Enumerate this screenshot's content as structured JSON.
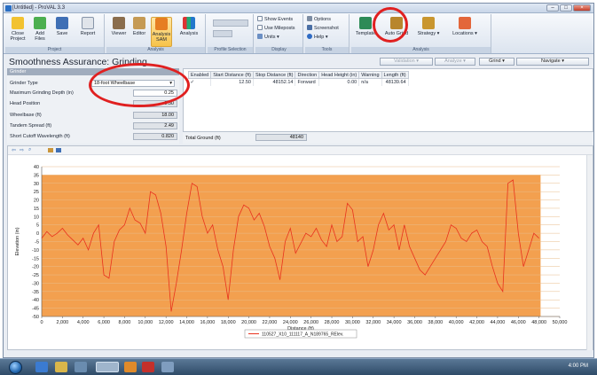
{
  "app": {
    "title": "[Untitled] - ProVAL 3.3"
  },
  "window_buttons": [
    "–",
    "□",
    "×"
  ],
  "ribbon": {
    "project_group": "Project",
    "close_project": "Close Project",
    "add_files": "Add Files",
    "save": "Save",
    "report": "Report",
    "view_group": "View",
    "viewer": "Viewer",
    "editor": "Editor",
    "analysis_sam": "Analysis SAM",
    "analysis": "Analysis",
    "profile_group": "Profile Selection",
    "display_group": "Display",
    "show_events": "Show Events",
    "use_mileposts": "Use Mileposts",
    "units": "Units",
    "tools_group": "Tools",
    "options": "Options",
    "screenshot": "Screenshot",
    "help": "Help",
    "template": "Template",
    "auto_grind": "Auto Grind",
    "strategy": "Strategy",
    "locations": "Locations",
    "analysis_group": "Analysis"
  },
  "page": {
    "title": "Smoothness Assurance: Grinding",
    "btn_validation": "Validation",
    "btn_analyze": "Analyze",
    "btn_grind": "Grind",
    "btn_navigate": "Navigate"
  },
  "grinder": {
    "header": "Grinder",
    "type_label": "Grinder Type",
    "type_value": "18-foot Wheelbase",
    "depth_label": "Maximum Grinding Depth (in)",
    "depth_value": "0.25",
    "head_label": "Head Position",
    "head_value": "9.50",
    "wheelbase_label": "Wheelbase (ft)",
    "wheelbase_value": "18.00",
    "tandem_label": "Tandem Spread (ft)",
    "tandem_value": "2.49",
    "cutoff_label": "Short Cutoff Wavelength (ft)",
    "cutoff_value": "0.820"
  },
  "table": {
    "headers": [
      "Enabled",
      "Start Distance (ft)",
      "Stop Distance (ft)",
      "Direction",
      "Head Height (in)",
      "Warning",
      "Length (ft)"
    ],
    "rows": [
      [
        "✓",
        "12.50",
        "48152.14",
        "Forward",
        "0.00",
        "n/a",
        "48139.64"
      ]
    ]
  },
  "total": {
    "label": "Total Ground (ft)",
    "value": "48140"
  },
  "chart_data": {
    "type": "line",
    "xlabel": "Distance (ft)",
    "ylabel": "Elevation (in)",
    "xlim": [
      0,
      50000
    ],
    "ylim": [
      -50,
      40
    ],
    "xticks": [
      "0",
      "2,000",
      "4,000",
      "6,000",
      "8,000",
      "10,000",
      "12,000",
      "14,000",
      "16,000",
      "18,000",
      "20,000",
      "22,000",
      "24,000",
      "26,000",
      "28,000",
      "30,000",
      "32,000",
      "34,000",
      "36,000",
      "38,000",
      "40,000",
      "42,000",
      "44,000",
      "46,000",
      "48,000",
      "50,000"
    ],
    "yticks": [
      "40",
      "35",
      "30",
      "25",
      "20",
      "15",
      "10",
      "5",
      "0",
      "-5",
      "-10",
      "-15",
      "-20",
      "-25",
      "-30",
      "-35",
      "-40",
      "-45",
      "-50"
    ],
    "shaded_region": {
      "x": [
        0,
        48150
      ],
      "y": [
        -50,
        35
      ]
    },
    "series": [
      {
        "name": "110527_X10_111117_A_N189765_RElev.",
        "color": "#e8321e",
        "x": [
          0,
          500,
          1000,
          1500,
          2000,
          2500,
          3000,
          3500,
          4000,
          4500,
          5000,
          5500,
          6000,
          6500,
          7000,
          7500,
          8000,
          8500,
          9000,
          9500,
          10000,
          10500,
          11000,
          11500,
          12000,
          12500,
          13000,
          13500,
          14000,
          14500,
          15000,
          15500,
          16000,
          16500,
          17000,
          17500,
          18000,
          18500,
          19000,
          19500,
          20000,
          20500,
          21000,
          21500,
          22000,
          22500,
          23000,
          23500,
          24000,
          24500,
          25000,
          25500,
          26000,
          26500,
          27000,
          27500,
          28000,
          28500,
          29000,
          29500,
          30000,
          30500,
          31000,
          31500,
          32000,
          32500,
          33000,
          33500,
          34000,
          34500,
          35000,
          35500,
          36000,
          36500,
          37000,
          37500,
          38000,
          38500,
          39000,
          39500,
          40000,
          40500,
          41000,
          41500,
          42000,
          42500,
          43000,
          43500,
          44000,
          44500,
          45000,
          45500,
          46000,
          46500,
          47000,
          47500,
          48000
        ],
        "y": [
          -3,
          1,
          -2,
          0,
          3,
          -1,
          -4,
          -7,
          -3,
          -10,
          0,
          5,
          -25,
          -27,
          -5,
          2,
          5,
          15,
          8,
          6,
          0,
          25,
          23,
          12,
          -8,
          -47,
          -30,
          -10,
          12,
          30,
          28,
          10,
          0,
          5,
          -10,
          -20,
          -40,
          -10,
          10,
          17,
          15,
          8,
          12,
          4,
          -8,
          -15,
          -28,
          -5,
          3,
          -12,
          -6,
          0,
          -2,
          3,
          -4,
          -8,
          5,
          -5,
          -2,
          18,
          14,
          -5,
          -2,
          -20,
          -10,
          5,
          12,
          2,
          5,
          -10,
          5,
          -8,
          -15,
          -22,
          -25,
          -20,
          -15,
          -10,
          -5,
          5,
          3,
          -3,
          -5,
          0,
          2,
          -5,
          -8,
          -20,
          -30,
          -35,
          30,
          32,
          0,
          -20,
          -10,
          0,
          -3
        ]
      }
    ]
  }
}
